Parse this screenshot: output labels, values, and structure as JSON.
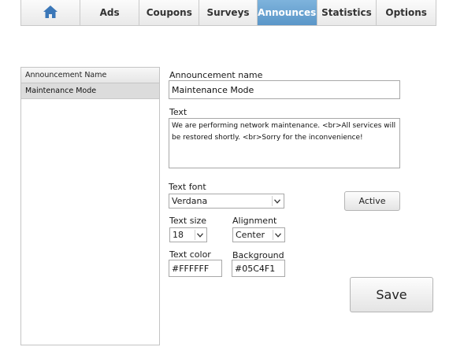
{
  "tabs": [
    {
      "icon": "home-icon",
      "label": ""
    },
    {
      "label": "Ads"
    },
    {
      "label": "Coupons"
    },
    {
      "label": "Surveys"
    },
    {
      "label": "Announces",
      "active": true
    },
    {
      "label": "Statistics"
    },
    {
      "label": "Options"
    }
  ],
  "list": {
    "header": "Announcement Name",
    "items": [
      "Maintenance Mode"
    ]
  },
  "form": {
    "name_label": "Announcement name",
    "name_value": "Maintenance Mode",
    "text_label": "Text",
    "text_value": "We are performing network maintenance. <br>All services will be restored shortly. <br>Sorry for the inconvenience!",
    "font_label": "Text font",
    "font_value": "Verdana",
    "size_label": "Text size",
    "size_value": "18",
    "align_label": "Alignment",
    "align_value": "Center",
    "color_label": "Text color",
    "color_value": "#FFFFFF",
    "bg_label": "Background",
    "bg_value": "#05C4F1",
    "active_label": "Active",
    "save_label": "Save"
  },
  "colors": {
    "accent": "#5a96c8",
    "home_icon": "#3b77b8"
  }
}
